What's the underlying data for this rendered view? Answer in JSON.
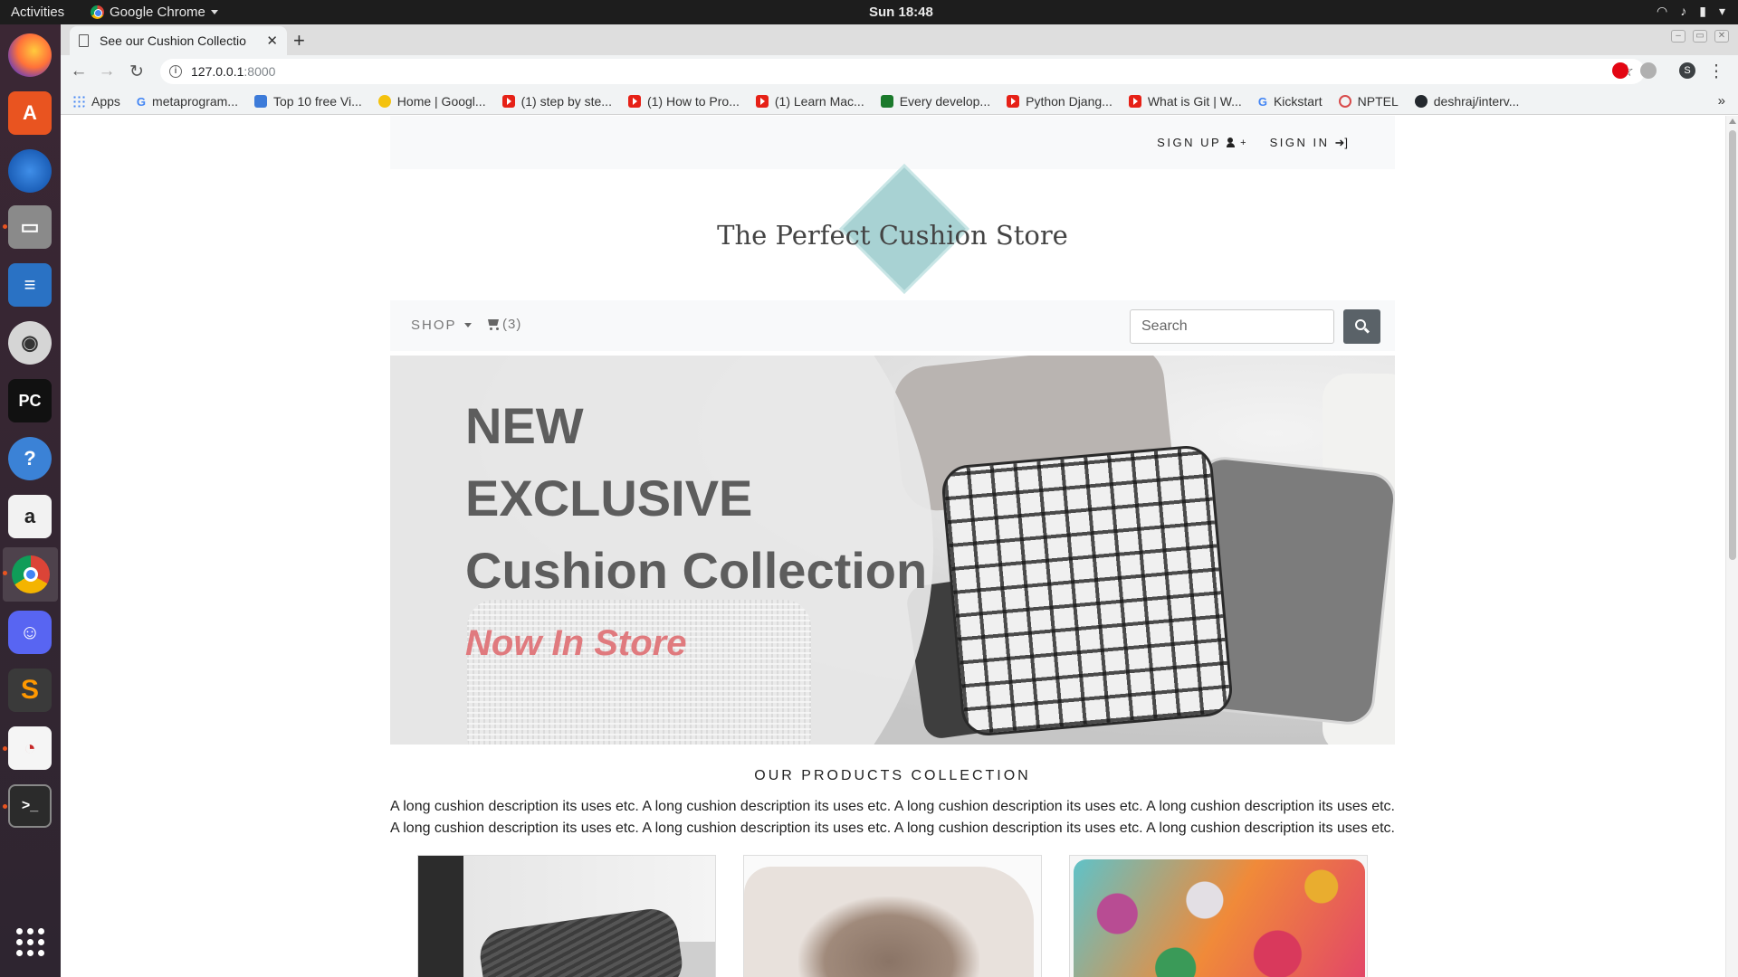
{
  "system": {
    "activities": "Activities",
    "app_name": "Google Chrome",
    "clock": "Sun 18:48"
  },
  "dock": {
    "apps": [
      "firefox",
      "ubuntu-software",
      "thunderbird",
      "files",
      "libreoffice-writer",
      "rhythmbox",
      "pycharm",
      "help",
      "amazon",
      "chrome",
      "discord",
      "sublime-text",
      "evince",
      "terminal",
      "show-applications"
    ]
  },
  "browser": {
    "tab_title": "See our Cushion Collectio",
    "url_host": "127.0.0.1",
    "url_port": ":8000",
    "profile_initial": "S",
    "bookmarks": [
      {
        "label": "Apps",
        "icon": "apps-grid-icon"
      },
      {
        "label": "metaprogram...",
        "icon": "google-icon"
      },
      {
        "label": "Top 10 free Vi...",
        "icon": "site-icon"
      },
      {
        "label": "Home | Googl...",
        "icon": "sun-icon"
      },
      {
        "label": "(1) step by ste...",
        "icon": "youtube-icon"
      },
      {
        "label": "(1) How to Pro...",
        "icon": "youtube-icon"
      },
      {
        "label": "(1) Learn Mac...",
        "icon": "youtube-icon"
      },
      {
        "label": "Every develop...",
        "icon": "site-icon"
      },
      {
        "label": "Python Djang...",
        "icon": "youtube-icon"
      },
      {
        "label": "What is Git | W...",
        "icon": "youtube-icon"
      },
      {
        "label": "Kickstart",
        "icon": "google-icon"
      },
      {
        "label": "NPTEL",
        "icon": "nptel-icon"
      },
      {
        "label": "deshraj/interv...",
        "icon": "github-icon"
      }
    ],
    "bookmarks_more": "»"
  },
  "page": {
    "auth": {
      "sign_up": "SIGN UP",
      "sign_in": "SIGN IN"
    },
    "store_name": "The Perfect Cushion Store",
    "nav": {
      "shop": "SHOP",
      "cart_count": "(3)",
      "search_placeholder": "Search"
    },
    "hero": {
      "line1": "NEW",
      "line2": "EXCLUSIVE",
      "line3": "Cushion Collection",
      "line4": "Now In Store"
    },
    "collection_title": "OUR PRODUCTS COLLECTION",
    "collection_desc": "A long cushion description its uses etc. A long cushion description its uses etc. A long cushion description its uses etc. A long cushion description its uses etc. A long cushion description its uses etc. A long cushion description its uses etc. A long cushion description its uses etc. A long cushion description its uses etc."
  },
  "colors": {
    "hero_accent": "#e07a7e",
    "logo_teal": "#a8d2d3",
    "search_button": "#5a6268"
  }
}
